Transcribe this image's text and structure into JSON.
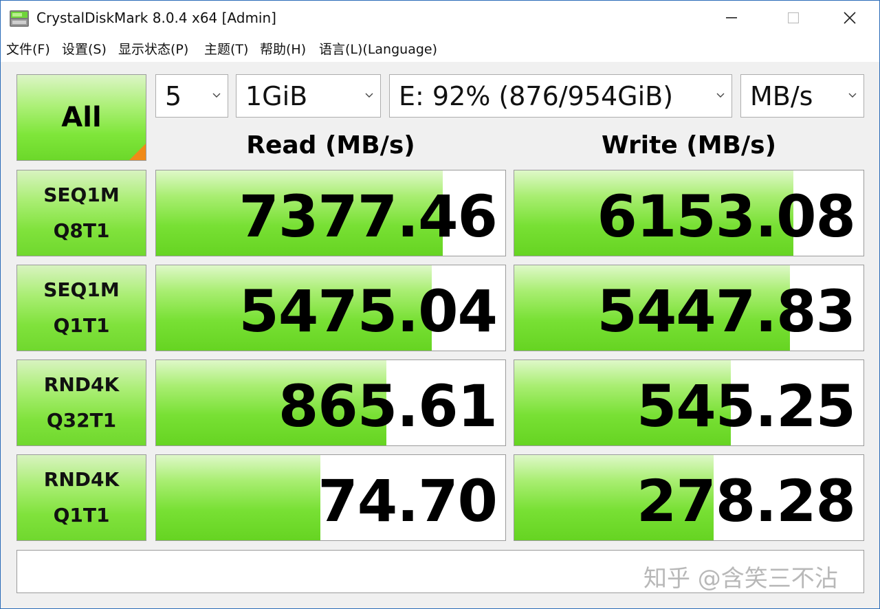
{
  "window": {
    "title": "CrystalDiskMark 8.0.4 x64 [Admin]"
  },
  "menu": [
    "文件(F)",
    "设置(S)",
    "显示状态(P)",
    "主题(T)",
    "帮助(H)",
    "语言(L)(Language)"
  ],
  "controls": {
    "all_label": "All",
    "count": "5",
    "size": "1GiB",
    "drive": "E: 92% (876/954GiB)",
    "unit": "MB/s"
  },
  "headers": {
    "read": "Read (MB/s)",
    "write": "Write (MB/s)"
  },
  "tests": [
    {
      "line1": "SEQ1M",
      "line2": "Q8T1",
      "read": "7377.46",
      "write": "6153.08",
      "read_fill": 0.82,
      "write_fill": 0.8
    },
    {
      "line1": "SEQ1M",
      "line2": "Q1T1",
      "read": "5475.04",
      "write": "5447.83",
      "read_fill": 0.79,
      "write_fill": 0.79
    },
    {
      "line1": "RND4K",
      "line2": "Q32T1",
      "read": "865.61",
      "write": "545.25",
      "read_fill": 0.66,
      "write_fill": 0.62
    },
    {
      "line1": "RND4K",
      "line2": "Q1T1",
      "read": "74.70",
      "write": "278.28",
      "read_fill": 0.47,
      "write_fill": 0.57
    }
  ],
  "comment": "",
  "watermark": "知乎 @含笑三不沾",
  "colors": {
    "bar_green": "#78e034",
    "corner_orange": "#f08a18",
    "border_blue": "#2b6cb8"
  }
}
